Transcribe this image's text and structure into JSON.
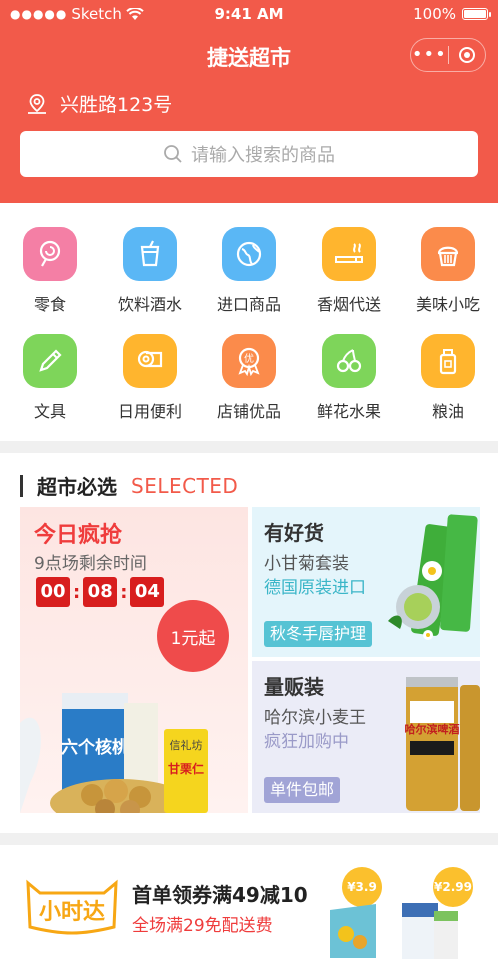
{
  "status": {
    "carrier": "Sketch",
    "time": "9:41 AM",
    "battery": "100%"
  },
  "nav": {
    "title": "捷送超市",
    "more": "•••"
  },
  "location": {
    "address": "兴胜路123号"
  },
  "search": {
    "placeholder": "请输入搜索的商品"
  },
  "categories": [
    {
      "label": "零食",
      "icon": "lollipop-icon",
      "color": "#f47fa5"
    },
    {
      "label": "饮料酒水",
      "icon": "drink-cup-icon",
      "color": "#5ab7f5"
    },
    {
      "label": "进口商品",
      "icon": "globe-icon",
      "color": "#5ab7f5"
    },
    {
      "label": "香烟代送",
      "icon": "cigarette-icon",
      "color": "#ffb52e"
    },
    {
      "label": "美味小吃",
      "icon": "cupcake-icon",
      "color": "#fb8b4b"
    },
    {
      "label": "文具",
      "icon": "pencil-icon",
      "color": "#7ed55a"
    },
    {
      "label": "日用便利",
      "icon": "tissue-roll-icon",
      "color": "#ffb52e"
    },
    {
      "label": "店铺优品",
      "icon": "medal-icon",
      "color": "#fb8b4b"
    },
    {
      "label": "鲜花水果",
      "icon": "cherry-icon",
      "color": "#7ed55a"
    },
    {
      "label": "粮油",
      "icon": "oil-bottle-icon",
      "color": "#ffb52e"
    }
  ],
  "selected": {
    "title": "超市必选",
    "subtitle": "SELECTED",
    "flash": {
      "title": "今日疯抢",
      "subtitle": "9点场剩余时间",
      "countdown": [
        "00",
        "08",
        "04"
      ],
      "badge": "1元起",
      "product_can_text": "六个核桃",
      "product_bag_text": "甘栗仁",
      "product_bag_brand": "信礼坊"
    },
    "good": {
      "title": "有好货",
      "line1": "小甘菊套装",
      "line2": "德国原装进口",
      "tag": "秋冬手唇护理"
    },
    "bulk": {
      "title": "量贩装",
      "line1": "哈尔滨小麦王",
      "line2": "疯狂加购中",
      "tag": "单件包邮",
      "beer_label": "哈尔滨啤酒"
    }
  },
  "promo": {
    "logo_text": "小时达",
    "title": "首单领券满49减10",
    "subtitle": "全场满29免配送费",
    "prices": [
      "¥3.9",
      "¥2.99"
    ]
  }
}
